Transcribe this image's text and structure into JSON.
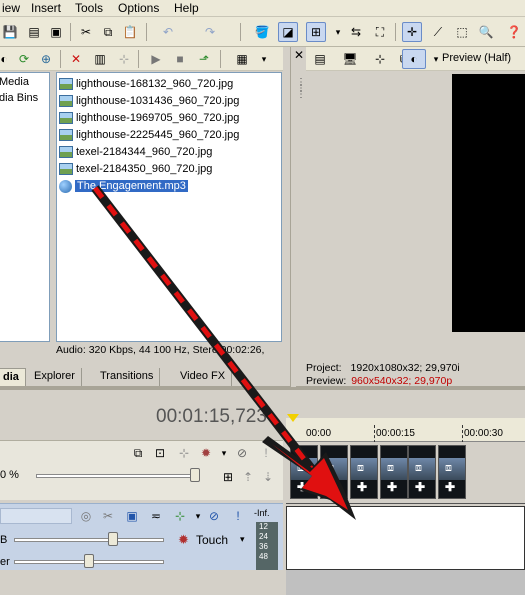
{
  "menu": {
    "view": "iew",
    "insert": "Insert",
    "tools": "Tools",
    "options": "Options",
    "help": "Help"
  },
  "explorer_tree": {
    "items": [
      "Media",
      "dia Bins"
    ]
  },
  "files": [
    "lighthouse-168132_960_720.jpg",
    "lighthouse-1031436_960_720.jpg",
    "lighthouse-1969705_960_720.jpg",
    "lighthouse-2225445_960_720.jpg",
    "texel-2184344_960_720.jpg",
    "texel-2184350_960_720.jpg",
    "The Engagement.mp3"
  ],
  "media_status": "Audio: 320 Kbps, 44 100 Hz, Stere",
  "media_status_tail": "00:02:26,",
  "tabs": {
    "media": "dia",
    "explorer": "Explorer",
    "transitions": "Transitions",
    "video_fx": "Video FX"
  },
  "preview": {
    "mode": "Preview (Half)",
    "project_label": "Project:",
    "project_value": "1920x1080x32; 29,970i",
    "preview_label": "Preview:",
    "preview_value": "960x540x32; 29,970p"
  },
  "timeline": {
    "timecode": "00:01:15,723",
    "ruler": [
      "00:00",
      "00:00:15",
      "00:00:30"
    ],
    "zoom_label": "0 %",
    "track_label_b": "B",
    "track_label_er": "er",
    "touch_label": "Touch",
    "meter_label": "-Inf.",
    "meter_values": [
      "12",
      "24",
      "36",
      "48"
    ]
  },
  "colors": {
    "selection": "#316ac5",
    "arrow_red": "#e01010",
    "preview_red": "#c00000"
  }
}
